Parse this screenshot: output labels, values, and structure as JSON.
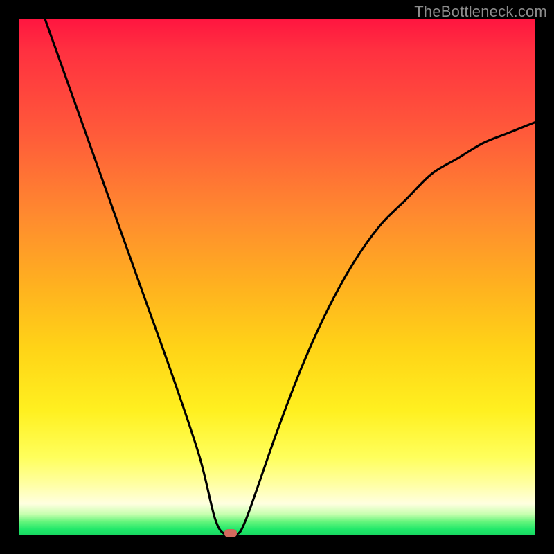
{
  "watermark": "TheBottleneck.com",
  "chart_data": {
    "type": "line",
    "title": "",
    "xlabel": "",
    "ylabel": "",
    "xlim": [
      0,
      100
    ],
    "ylim": [
      0,
      100
    ],
    "gradient_meaning": "green (good / no bottleneck) at bottom, red (severe bottleneck) at top",
    "curve": {
      "description": "V-shaped bottleneck curve; descends from upper-left, reaches 0 near x≈41, rises and flattens toward upper-right",
      "points": [
        {
          "x": 5,
          "y": 100
        },
        {
          "x": 10,
          "y": 86
        },
        {
          "x": 15,
          "y": 72
        },
        {
          "x": 20,
          "y": 58
        },
        {
          "x": 25,
          "y": 44
        },
        {
          "x": 30,
          "y": 30
        },
        {
          "x": 35,
          "y": 15
        },
        {
          "x": 38,
          "y": 3
        },
        {
          "x": 40,
          "y": 0
        },
        {
          "x": 42,
          "y": 0
        },
        {
          "x": 44,
          "y": 3
        },
        {
          "x": 50,
          "y": 20
        },
        {
          "x": 55,
          "y": 33
        },
        {
          "x": 60,
          "y": 44
        },
        {
          "x": 65,
          "y": 53
        },
        {
          "x": 70,
          "y": 60
        },
        {
          "x": 75,
          "y": 65
        },
        {
          "x": 80,
          "y": 70
        },
        {
          "x": 85,
          "y": 73
        },
        {
          "x": 90,
          "y": 76
        },
        {
          "x": 95,
          "y": 78
        },
        {
          "x": 100,
          "y": 80
        }
      ]
    },
    "marker": {
      "x": 41,
      "y": 0,
      "color": "#d46a5e"
    },
    "colors": {
      "frame": "#000000",
      "gradient_top": "#ff1640",
      "gradient_bottom": "#18d861",
      "curve": "#000000",
      "watermark": "#8d8d8d"
    }
  }
}
